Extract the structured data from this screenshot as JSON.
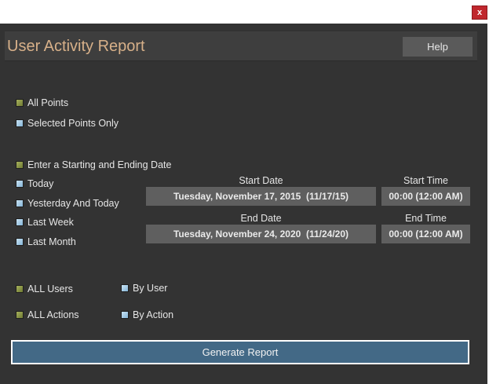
{
  "window": {
    "close_label": "x"
  },
  "header": {
    "title": "User Activity Report",
    "help_label": "Help"
  },
  "points": {
    "all_points": {
      "label": "All Points",
      "checked": true
    },
    "selected_points_only": {
      "label": "Selected Points Only",
      "checked": false
    }
  },
  "date_range": {
    "options": [
      {
        "label": "Enter a Starting and Ending Date",
        "checked": true
      },
      {
        "label": "Today",
        "checked": false
      },
      {
        "label": "Yesterday And Today",
        "checked": false
      },
      {
        "label": "Last Week",
        "checked": false
      },
      {
        "label": "Last Month",
        "checked": false
      }
    ],
    "start_date_label": "Start Date",
    "start_time_label": "Start Time",
    "start_date_value": "Tuesday, November 17, 2015  (11/17/15)",
    "start_time_value": "00:00 (12:00 AM)",
    "end_date_label": "End Date",
    "end_time_label": "End Time",
    "end_date_value": "Tuesday, November 24, 2020  (11/24/20)",
    "end_time_value": "00:00 (12:00 AM)"
  },
  "users": {
    "all_users": {
      "label": "ALL Users",
      "checked": true
    },
    "by_user": {
      "label": "By User",
      "checked": false
    }
  },
  "actions": {
    "all_actions": {
      "label": "ALL Actions",
      "checked": true
    },
    "by_action": {
      "label": "By Action",
      "checked": false
    }
  },
  "footer": {
    "generate_label": "Generate Report"
  },
  "colors": {
    "background": "#333333",
    "title": "#d7b089",
    "checked_box": "#8d9847",
    "unchecked_box": "#a8cde6",
    "generate_button": "#436986",
    "close_button": "#c0272d"
  }
}
